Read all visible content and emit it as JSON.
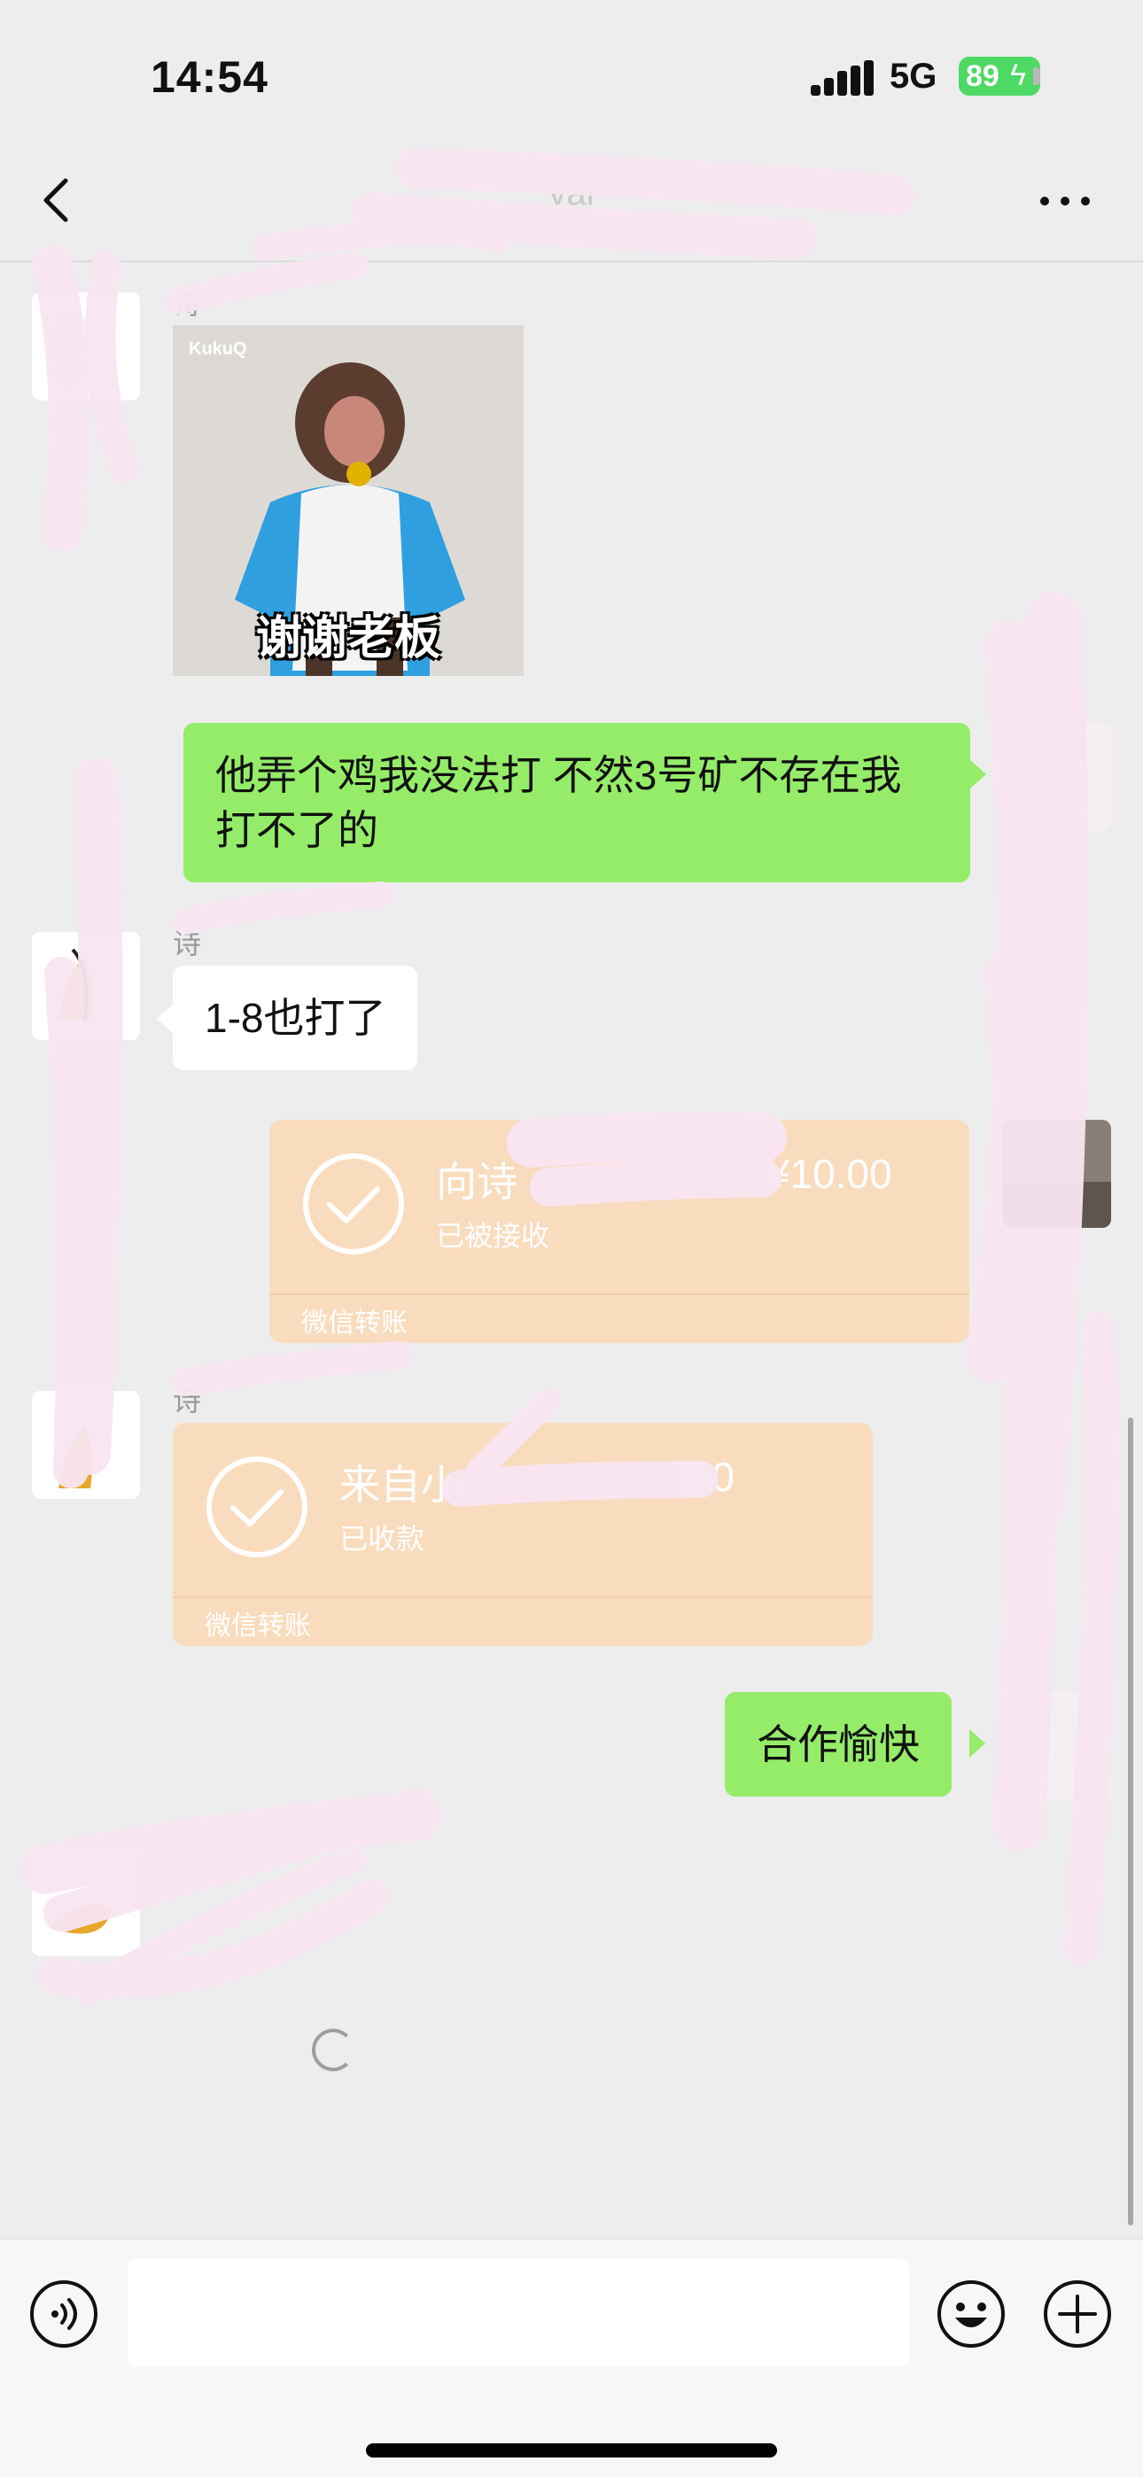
{
  "status_bar": {
    "time": "14:54",
    "network": "5G",
    "battery": "89"
  },
  "header": {
    "title": "vai"
  },
  "messages": [
    {
      "kind": "sticker",
      "side": "left",
      "sender_name": "诗",
      "brand": "KukuQ",
      "caption": "谢谢老板"
    },
    {
      "kind": "text",
      "side": "right",
      "text": "他弄个鸡我没法打 不然3号矿不存在我打不了的"
    },
    {
      "kind": "text",
      "side": "left",
      "sender_name": "诗",
      "text": "1-8也打了"
    },
    {
      "kind": "transfer",
      "side": "right",
      "title": "向诗",
      "amount": "¥10.00",
      "status": "已被接收",
      "footer": "微信转账"
    },
    {
      "kind": "transfer",
      "side": "left",
      "sender_name": "诗",
      "title": "来自小",
      "amount": ".00",
      "status": "已收款",
      "footer": "微信转账"
    },
    {
      "kind": "text",
      "side": "right",
      "text": "合作愉快"
    }
  ],
  "input": {
    "value": ""
  },
  "colors": {
    "background": "#ededed",
    "own_bubble": "#95ec69",
    "other_bubble": "#ffffff",
    "transfer_card": "#f9dcbe",
    "battery": "#4cd964"
  },
  "icons": [
    "back-icon",
    "more-icon",
    "voice-icon",
    "emoji-icon",
    "plus-icon",
    "check-icon",
    "loading-spinner"
  ]
}
